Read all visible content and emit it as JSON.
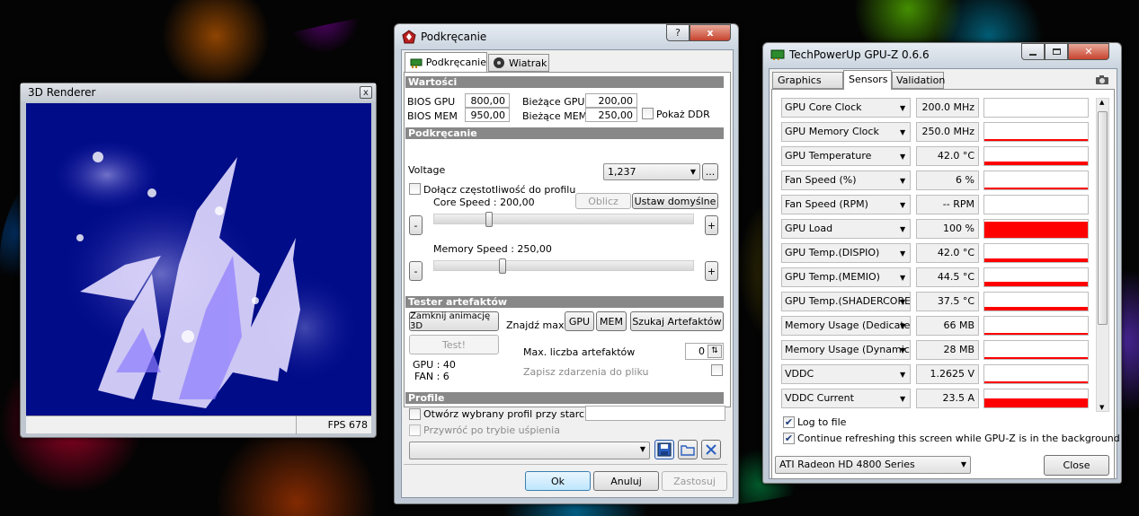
{
  "renderer": {
    "title": "3D Renderer",
    "close": "x",
    "fps": "FPS 678"
  },
  "overclock": {
    "title": "Podkręcanie",
    "title_buttons": {
      "help": "?",
      "close": "x"
    },
    "tabs": [
      {
        "label": "Podkręcanie"
      },
      {
        "label": "Wiatrak"
      }
    ],
    "section_values": "Wartości",
    "bios_gpu_label": "BIOS GPU",
    "bios_gpu_value": "800,00",
    "bios_mem_label": "BIOS MEM",
    "bios_mem_value": "950,00",
    "cur_gpu_label": "Bieżące GPU",
    "cur_gpu_value": "200,00",
    "cur_mem_label": "Bieżące MEM",
    "cur_mem_value": "250,00",
    "show_ddr_label": "Pokaż DDR",
    "section_oc": "Podkręcanie",
    "voltage_label": "Voltage",
    "voltage_value": "1,237",
    "voltage_more": "...",
    "attach_freq_label": "Dołącz częstotliwość do profilu",
    "core_speed_label": "Core Speed : 200,00",
    "core_speed_level": 0.2,
    "calc_button": "Oblicz",
    "defaults_button": "Ustaw domyślne",
    "minus": "-",
    "plus": "+",
    "mem_speed_label": "Memory Speed : 250,00",
    "mem_speed_level": 0.25,
    "section_tester": "Tester artefaktów",
    "close_anim_button": "Zamknij animację 3D",
    "find_max_label": "Znajdź max",
    "gpu_button": "GPU",
    "mem_button": "MEM",
    "search_button": "Szukaj Artefaktów",
    "test_button": "Test!",
    "max_artifacts_label": "Max. liczba artefaktów",
    "max_artifacts_value": "0",
    "gpu_status": "GPU : 40",
    "fan_status": "FAN : 6",
    "save_events_label": "Zapisz zdarzenia do pliku",
    "section_profile": "Profile",
    "open_profile_label": "Otwórz wybrany profil przy starcie",
    "restore_sleep_label": "Przywróć po trybie uśpienia",
    "ok_button": "Ok",
    "cancel_button": "Anuluj",
    "apply_button": "Zastosuj"
  },
  "gpuz": {
    "title": "TechPowerUp GPU-Z 0.6.6",
    "tabs": [
      {
        "label": "Graphics Card"
      },
      {
        "label": "Sensors"
      },
      {
        "label": "Validation"
      }
    ],
    "sensors": [
      {
        "name": "GPU Core Clock",
        "value": "200.0 MHz",
        "level": 0
      },
      {
        "name": "GPU Memory Clock",
        "value": "250.0 MHz",
        "level": 0.06
      },
      {
        "name": "GPU Temperature",
        "value": "42.0 °C",
        "level": 0.22
      },
      {
        "name": "Fan Speed (%)",
        "value": "6 %",
        "level": 0.03
      },
      {
        "name": "Fan Speed (RPM)",
        "value": "-- RPM",
        "level": 0
      },
      {
        "name": "GPU Load",
        "value": "100 %",
        "level": 1
      },
      {
        "name": "GPU Temp.(DISPIO)",
        "value": "42.0 °C",
        "level": 0.22
      },
      {
        "name": "GPU Temp.(MEMIO)",
        "value": "44.5 °C",
        "level": 0.25
      },
      {
        "name": "GPU Temp.(SHADERCORE)",
        "value": "37.5 °C",
        "level": 0.2
      },
      {
        "name": "Memory Usage (Dedicated)",
        "value": "66 MB",
        "level": 0.06
      },
      {
        "name": "Memory Usage (Dynamic)",
        "value": "28 MB",
        "level": 0.04
      },
      {
        "name": "VDDC",
        "value": "1.2625 V",
        "level": 0.05
      },
      {
        "name": "VDDC Current",
        "value": "23.5 A",
        "level": 0.5
      }
    ],
    "log_to_file": "Log to file",
    "continue_refresh": "Continue refreshing this screen while GPU-Z is in the background",
    "device": "ATI Radeon HD 4800 Series",
    "close_button": "Close"
  }
}
